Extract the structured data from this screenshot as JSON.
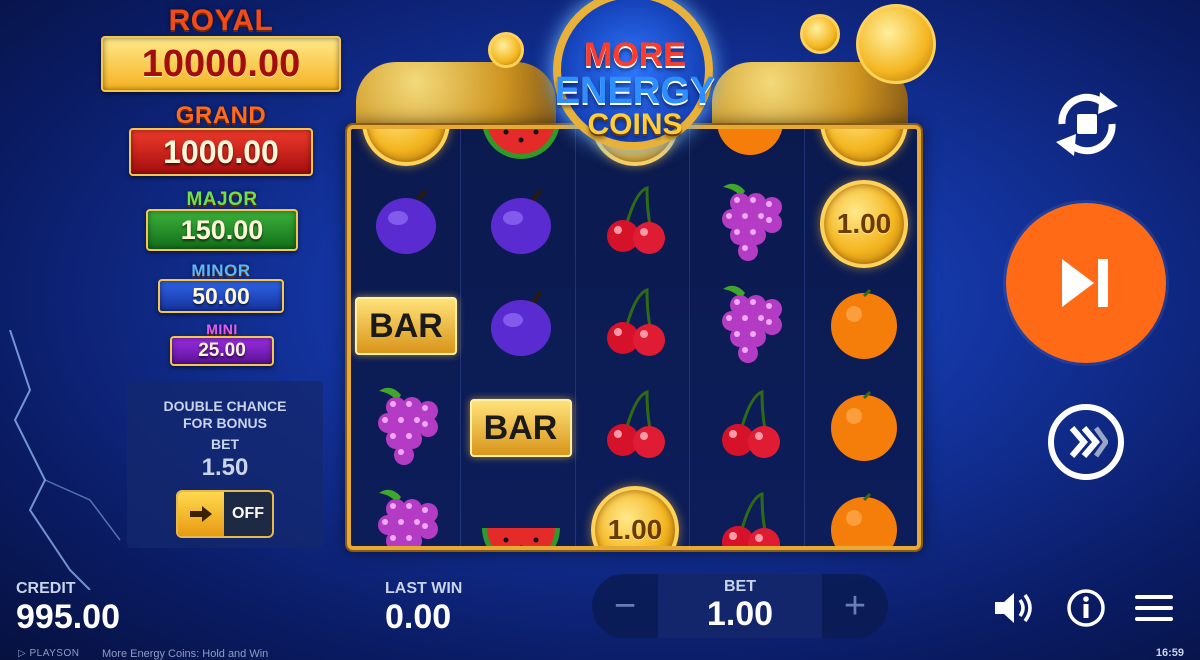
{
  "jackpots": {
    "royal": {
      "label": "ROYAL",
      "value": "10000.00"
    },
    "grand": {
      "label": "GRAND",
      "value": "1000.00"
    },
    "major": {
      "label": "MAJOR",
      "value": "150.00"
    },
    "minor": {
      "label": "MINOR",
      "value": "50.00"
    },
    "mini": {
      "label": "MINI",
      "value": "25.00"
    }
  },
  "double_chance": {
    "title": "DOUBLE CHANCE FOR BONUS",
    "bet_label": "BET",
    "bet_value": "1.50",
    "toggle_label": "OFF"
  },
  "logo": {
    "line1": "MORE",
    "line2": "ENERGY",
    "line3": "COINS"
  },
  "reels": [
    {
      "symbols": [
        "coin",
        "plum",
        "bar",
        "grapes",
        "grapes"
      ],
      "coin_values": [
        "",
        "",
        "",
        "",
        ""
      ]
    },
    {
      "symbols": [
        "watermelon",
        "plum",
        "plum",
        "bar",
        "watermelon"
      ],
      "coin_values": [
        "",
        "",
        "",
        "",
        ""
      ]
    },
    {
      "symbols": [
        "coin",
        "cherry",
        "cherry",
        "cherry",
        "coin"
      ],
      "coin_values": [
        "",
        "",
        "",
        "",
        "1.00"
      ]
    },
    {
      "symbols": [
        "orange",
        "grapes",
        "grapes",
        "cherry",
        "cherry"
      ],
      "coin_values": [
        "",
        "",
        "",
        "",
        ""
      ]
    },
    {
      "symbols": [
        "coin",
        "coin",
        "orange",
        "orange",
        "orange"
      ],
      "coin_values": [
        "",
        "1.00",
        "",
        "",
        ""
      ]
    }
  ],
  "bar_text": "BAR",
  "bottom": {
    "credit_label": "CREDIT",
    "credit_value": "995.00",
    "last_win_label": "LAST WIN",
    "last_win_value": "0.00",
    "bet_label": "BET",
    "bet_value": "1.00",
    "minus": "−",
    "plus": "+"
  },
  "icons": {
    "autoplay": "autoplay-icon",
    "spin": "spin-icon",
    "turbo": "turbo-icon",
    "sound": "sound-icon",
    "info": "info-icon",
    "menu": "menu-icon"
  },
  "colors": {
    "spin_button": "#ff6a17",
    "frame_gold": "#e6a933",
    "background": "#123199"
  },
  "footer": {
    "brand": "PLAYSON",
    "game_name": "More Energy Coins: Hold and Win",
    "clock": "16:59"
  }
}
